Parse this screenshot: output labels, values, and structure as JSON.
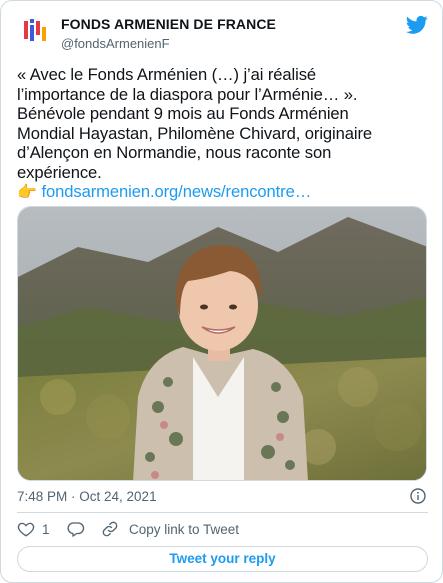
{
  "account": {
    "name": "FONDS ARMENIEN DE FRANCE",
    "handle": "@fondsArmenienF",
    "logo_colors": [
      "#e63946",
      "#3b5bdb",
      "#f4a300"
    ]
  },
  "tweet": {
    "lines": [
      "« Avec le Fonds Arménien (…) j’ai réalisé",
      "l’importance de la diaspora pour l’Arménie… ».",
      "Bénévole pendant 9 mois au Fonds Arménien",
      "Mondial Hayastan, Philomène Chivard, originaire",
      "d’Alençon en Normandie, nous raconte son",
      "expérience."
    ],
    "pointer_emoji": "👉",
    "link_text": "fondsarmenien.org/news/rencontre…"
  },
  "timestamp": "7:48 PM · Oct 24, 2021",
  "actions": {
    "like_count": "1",
    "copy_link_label": "Copy link to Tweet"
  },
  "reply_button_label": "Tweet your reply",
  "colors": {
    "accent": "#1d9bf0",
    "muted": "#536471",
    "border": "#cfd9de"
  },
  "icons": [
    "twitter-bird-icon",
    "info-icon",
    "heart-icon",
    "reply-icon",
    "link-icon"
  ]
}
